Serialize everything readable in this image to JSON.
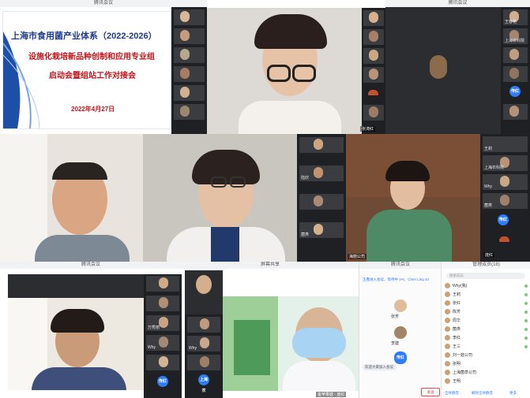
{
  "window_title": "腾讯会议",
  "slide": {
    "title": "上海市食用菌产业体系（2022-2026）",
    "subtitle1": "设施化栽培新品种创制和应用专业组",
    "subtitle2": "启动会暨组站工作对接会",
    "date": "2022年4月27日"
  },
  "colors": {
    "slide_title": "#1f3c8c",
    "slide_red": "#c0151b",
    "badge_blue": "#2e7cf6",
    "mushroom": "#c2522f"
  },
  "tile1_side": [
    "",
    "",
    "",
    "",
    "",
    ""
  ],
  "tile2_caption": "张涛红",
  "tile3_side": [
    "王春艳",
    "上海农科院",
    "",
    "",
    "",
    ""
  ],
  "tile5_side": [
    "",
    "陆欣",
    "",
    "",
    "菌类",
    ""
  ],
  "tile6_side": [
    "王莉",
    "上海农科院",
    "Why",
    "菌类",
    "传红",
    "庞红"
  ],
  "tile6_caption": "海丽公司",
  "tile7_side": [
    "",
    "",
    "万秀丽",
    "Why",
    "",
    "",
    "",
    ""
  ],
  "tile8_title": "屏幕共享",
  "tile8_side": [
    "",
    "",
    "Why",
    "",
    "上海农",
    ""
  ],
  "tile8_caption": "金苹果菇 · 庞红",
  "badge_label": "传红",
  "chat": {
    "header": "腾讯会议",
    "notice": "王鑫进入会议，等待中 2%；Chen Ling 34",
    "members": [
      {
        "name": "张芳",
        "badge": "传红"
      },
      {
        "name": "李建",
        "badge": ""
      }
    ],
    "input_hint": "欢迎大家加入会议",
    "send": "发送"
  },
  "participants": {
    "title": "管理成员(18)",
    "search_placeholder": "搜索成员",
    "list": [
      "Why(我)",
      "王莉",
      "张红",
      "陈芳",
      "周华",
      "菌类",
      "李红",
      "王三",
      "刘一菇公司",
      "张明",
      "上海菌草公司",
      "王明"
    ],
    "btn_mute_all": "全体静音",
    "btn_unmute": "解除全体静音",
    "btn_more": "更多"
  }
}
